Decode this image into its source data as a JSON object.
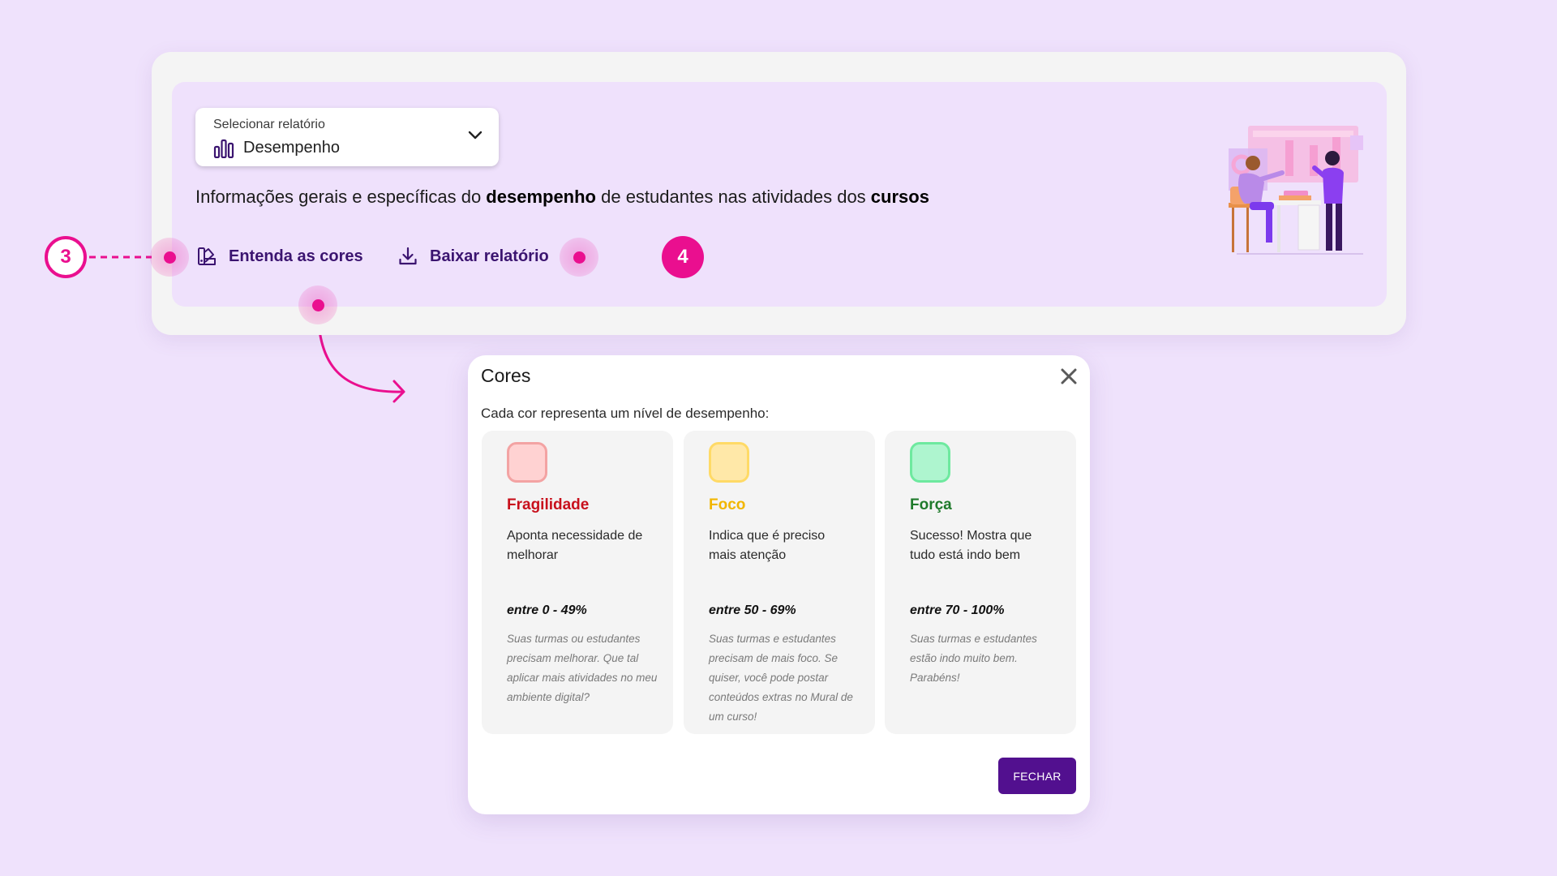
{
  "report": {
    "select_label": "Selecionar relatório",
    "select_value": "Desempenho",
    "description_parts": {
      "p1": "Informações gerais e específicas do ",
      "b1": "desempenho",
      "p2": " de estudantes nas atividades dos ",
      "b2": "cursos"
    },
    "understand_colors_label": "Entenda as cores",
    "download_label": "Baixar relatório"
  },
  "annotations": {
    "step_left": "3",
    "step_right": "4"
  },
  "modal": {
    "title": "Cores",
    "subtitle": "Cada cor representa um nível de desempenho:",
    "close_button": "FECHAR",
    "cards": [
      {
        "name": "Fragilidade",
        "name_color": "#c8101c",
        "swatch_fill": "#ffd2d2",
        "swatch_border": "#f3a3a3",
        "description": "Aponta necessidade de melhorar",
        "range": "entre 0 - 49%",
        "note": "Suas turmas ou estudantes precisam melhorar. Que tal aplicar mais atividades no meu ambiente digital?"
      },
      {
        "name": "Foco",
        "name_color": "#f2b600",
        "swatch_fill": "#ffe8a8",
        "swatch_border": "#ffda66",
        "description": "Indica que é preciso mais atenção",
        "range": "entre 50 - 69%",
        "note": "Suas turmas e estudantes precisam de mais foco. Se quiser, você pode postar conteúdos extras no Mural de um curso!"
      },
      {
        "name": "Força",
        "name_color": "#1f7a2b",
        "swatch_fill": "#aef5cf",
        "swatch_border": "#6ee99f",
        "description": "Sucesso! Mostra que tudo está indo bem",
        "range": "entre 70 - 100%",
        "note": "Suas turmas e estudantes estão indo muito bem. Parabéns!"
      }
    ]
  },
  "colors": {
    "accent_magenta": "#ea0f8f",
    "primary_purple": "#52108f",
    "background": "#efe2fc"
  },
  "icons": {
    "select": "bar-chart-icon",
    "chevron": "chevron-down-icon",
    "colors_link": "palette-icon",
    "download_link": "download-icon",
    "close": "close-icon"
  }
}
